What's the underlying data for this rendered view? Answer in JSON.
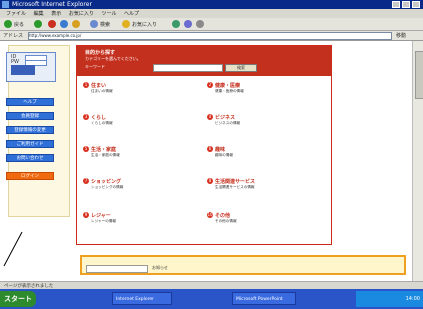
{
  "window": {
    "title": "Microsoft Internet Explorer"
  },
  "menu": [
    "ファイル",
    "編集",
    "表示",
    "お気に入り",
    "ツール",
    "ヘルプ"
  ],
  "toolbar": {
    "back_label": "戻る",
    "search_label": "検索",
    "favorites_label": "お気に入り"
  },
  "address": {
    "label": "アドレス",
    "url": "http://www.example.co.jp/",
    "go_label": "移動"
  },
  "sidebar": {
    "login_labels": [
      "ID",
      "PW"
    ],
    "buttons": [
      "ヘルプ",
      "会員登録",
      "登録情報の変更",
      "ご利用ガイド",
      "お問い合わせ"
    ],
    "orange_button": "ログイン"
  },
  "main": {
    "heading": "目的から探す",
    "lead": "カテゴリーを選んでください。",
    "search_label": "キーワード",
    "search_button": "検索",
    "categories": [
      {
        "num": "1",
        "title": "住まい",
        "body": "住まいの情報"
      },
      {
        "num": "2",
        "title": "健康・医療",
        "body": "健康・医療の情報"
      },
      {
        "num": "3",
        "title": "くらし",
        "body": "くらしの情報"
      },
      {
        "num": "4",
        "title": "ビジネス",
        "body": "ビジネスの情報"
      },
      {
        "num": "5",
        "title": "生活・家庭",
        "body": "生活・家庭の情報"
      },
      {
        "num": "6",
        "title": "趣味",
        "body": "趣味の情報"
      },
      {
        "num": "7",
        "title": "ショッピング",
        "body": "ショッピングの情報"
      },
      {
        "num": "8",
        "title": "生活関連サービス",
        "body": "生活関連サービスの情報"
      },
      {
        "num": "9",
        "title": "レジャー",
        "body": "レジャーの情報"
      },
      {
        "num": "10",
        "title": "その他",
        "body": "その他の情報"
      }
    ]
  },
  "bottom": {
    "text": "お知らせ"
  },
  "status": {
    "text": "ページが表示されました"
  },
  "taskbar": {
    "start": "スタート",
    "tasks": [
      "Internet Explorer",
      "Microsoft PowerPoint"
    ],
    "clock": "14:00"
  }
}
